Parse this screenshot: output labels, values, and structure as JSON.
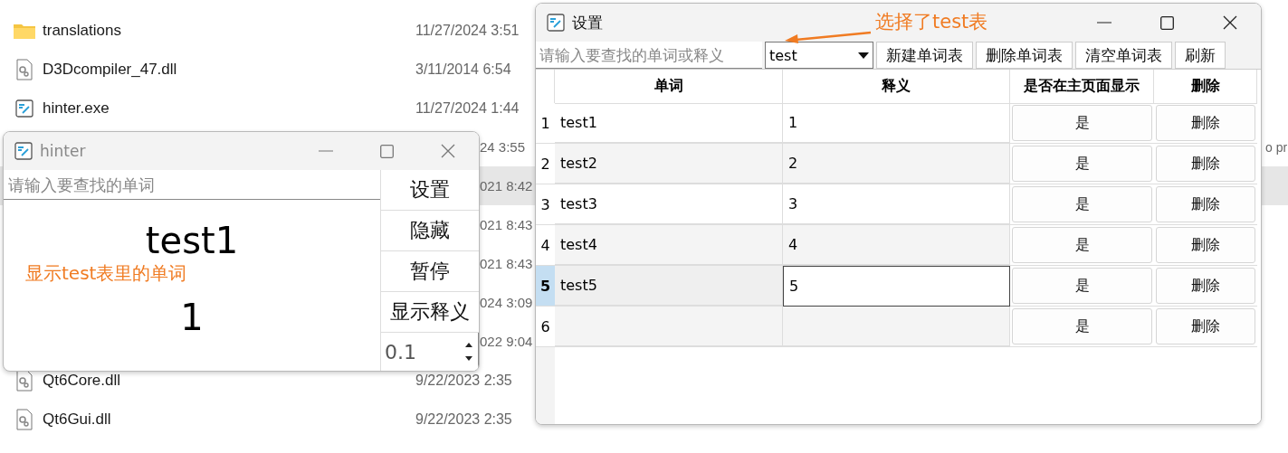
{
  "explorer": {
    "rows": [
      {
        "kind": "folder",
        "name": "translations",
        "date": "11/27/2024 3:51",
        "selected": false
      },
      {
        "kind": "dll",
        "name": "D3Dcompiler_47.dll",
        "date": "3/11/2014 6:54",
        "selected": false
      },
      {
        "kind": "exe",
        "name": "hinter.exe",
        "date": "11/27/2024 1:44",
        "selected": false
      },
      {
        "kind": "covered",
        "date": "24 3:55",
        "column_3": "o pr",
        "selected": false
      },
      {
        "kind": "covered",
        "date": "021 8:42",
        "selected": true
      },
      {
        "kind": "covered",
        "date": "021 8:43",
        "selected": false
      },
      {
        "kind": "covered",
        "date": "021 8:43",
        "selected": false
      },
      {
        "kind": "covered",
        "date": "024 3:09",
        "selected": false
      },
      {
        "kind": "covered",
        "date": "022 9:04",
        "selected": false
      },
      {
        "kind": "dll",
        "name": "Qt6Core.dll",
        "date": "9/22/2023 2:35",
        "selected": false
      },
      {
        "kind": "dll",
        "name": "Qt6Gui.dll",
        "date": "9/22/2023 2:35",
        "selected": false
      }
    ]
  },
  "hinter": {
    "title": "hinter",
    "search": {
      "placeholder": "请输入要查找的单词"
    },
    "word": "test1",
    "annotation": "显示test表里的单词",
    "meaning": "1",
    "buttons": [
      "设置",
      "隐藏",
      "暂停",
      "显示释义"
    ],
    "interval": "0.1"
  },
  "settings": {
    "title": "设置",
    "annotation": "选择了test表",
    "search": {
      "placeholder": "请输入要查找的单词或释义"
    },
    "wordbook": "test",
    "buttons": [
      "新建单词表",
      "删除单词表",
      "清空单词表",
      "刷新"
    ],
    "table": {
      "columns": [
        "单词",
        "释义",
        "是否在主页面显示",
        "删除"
      ],
      "rows": [
        {
          "number": "1",
          "word": "test1",
          "meaning": "1",
          "show": "是",
          "delete": "删除",
          "selected": false
        },
        {
          "number": "2",
          "word": "test2",
          "meaning": "2",
          "show": "是",
          "delete": "删除",
          "selected": false
        },
        {
          "number": "3",
          "word": "test3",
          "meaning": "3",
          "show": "是",
          "delete": "删除",
          "selected": false
        },
        {
          "number": "4",
          "word": "test4",
          "meaning": "4",
          "show": "是",
          "delete": "删除",
          "selected": false
        },
        {
          "number": "5",
          "word": "test5",
          "meaning": "5",
          "show": "是",
          "delete": "删除",
          "selected": true
        },
        {
          "number": "6",
          "show": "是",
          "delete": "删除",
          "selected": false
        }
      ]
    }
  }
}
